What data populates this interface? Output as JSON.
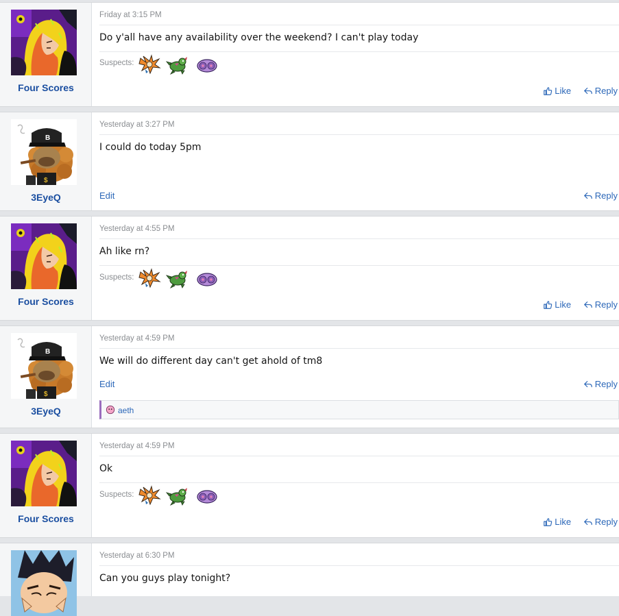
{
  "posts": [
    {
      "author": "Four Scores",
      "timestamp": "Friday at 3:15 PM",
      "message": "Do y'all have any availability over the weekend? I can't play today",
      "suspects_label": "Suspects:",
      "like_label": "Like",
      "reply_label": "Reply"
    },
    {
      "author": "3EyeQ",
      "timestamp": "Yesterday at 3:27 PM",
      "message": "I could do today 5pm",
      "edit_label": "Edit",
      "reply_label": "Reply"
    },
    {
      "author": "Four Scores",
      "timestamp": "Yesterday at 4:55 PM",
      "message": "Ah like rn?",
      "suspects_label": "Suspects:",
      "like_label": "Like",
      "reply_label": "Reply"
    },
    {
      "author": "3EyeQ",
      "timestamp": "Yesterday at 4:59 PM",
      "message": "We will do different day can't get ahold of tm8",
      "edit_label": "Edit",
      "reply_label": "Reply",
      "reaction_user": "aeth"
    },
    {
      "author": "Four Scores",
      "timestamp": "Yesterday at 4:59 PM",
      "message": "Ok",
      "suspects_label": "Suspects:",
      "like_label": "Like",
      "reply_label": "Reply"
    },
    {
      "timestamp": "Yesterday at 6:30 PM",
      "message": "Can you guys play tonight?"
    }
  ],
  "colors": {
    "link": "#2b67b8",
    "username": "#1a4ea0",
    "meta": "#8a8d91",
    "reaction_border": "#9a6dbd"
  },
  "icons": {
    "like": "thumbs-up-icon",
    "reply": "reply-arrow-icon",
    "sprites": [
      "flame-bird-sprite-icon",
      "green-lizard-sprite-icon",
      "pink-swirl-sprite-icon"
    ],
    "reaction": "pink-blob-react-icon"
  }
}
